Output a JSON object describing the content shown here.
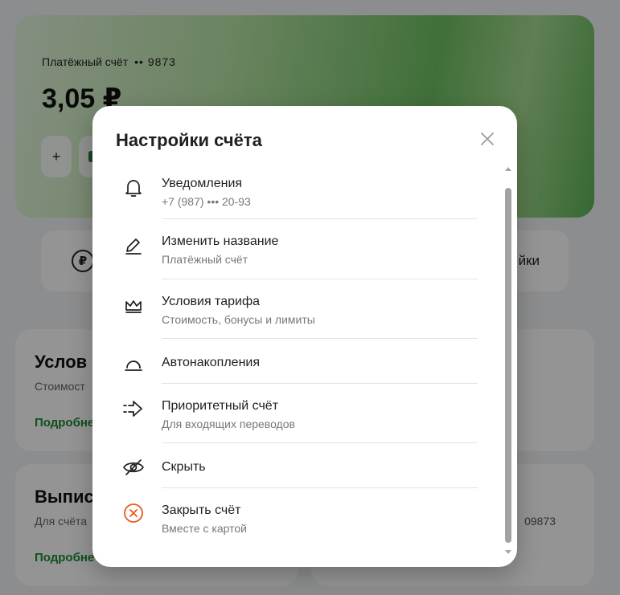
{
  "background": {
    "account": {
      "name": "Платёжный счёт",
      "number_mask": "•• 9873",
      "balance": "3,05 ₽",
      "plus_label": "+"
    },
    "tiles": {
      "ruble_symbol": "₽",
      "right_label": "йки"
    },
    "cards": [
      {
        "title": "Услов",
        "subtitle": "Стоимост",
        "link": "Подробне"
      },
      {
        "title": "Выпис",
        "subtitle": "Для счёта",
        "link": "Подробне",
        "right_text": "09873"
      }
    ]
  },
  "modal": {
    "title": "Настройки счёта",
    "items": [
      {
        "label": "Уведомления",
        "sub": "+7 (987) ••• 20-93",
        "icon": "bell-icon"
      },
      {
        "label": "Изменить название",
        "sub": "Платёжный счёт",
        "icon": "pencil-icon"
      },
      {
        "label": "Условия тарифа",
        "sub": "Стоимость, бонусы и лимиты",
        "icon": "crown-icon"
      },
      {
        "label": "Автонакопления",
        "sub": "",
        "icon": "gauge-icon"
      },
      {
        "label": "Приоритетный счёт",
        "sub": "Для входящих переводов",
        "icon": "arrow-right-icon"
      },
      {
        "label": "Скрыть",
        "sub": "",
        "icon": "eye-off-icon"
      },
      {
        "label": "Закрыть счёт",
        "sub": "Вместе с картой",
        "icon": "close-circle-icon"
      }
    ]
  },
  "colors": {
    "danger": "#e8591a",
    "link_green": "#1b8a2f",
    "accent_green": "#5eb457"
  }
}
